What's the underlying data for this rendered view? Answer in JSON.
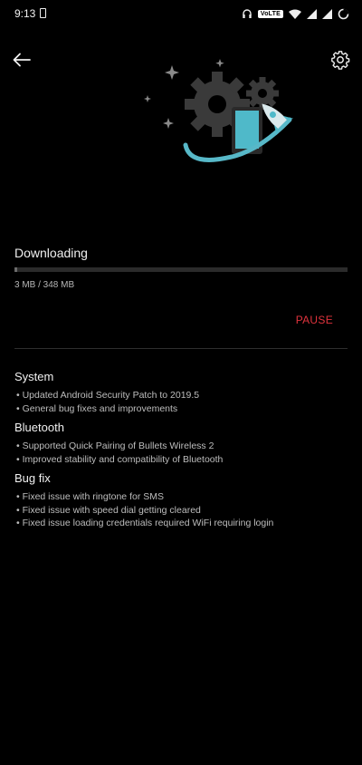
{
  "status_bar": {
    "time": "9:13",
    "network_badge": "VoLTE"
  },
  "header": {
    "back_icon": "arrow-left-icon",
    "settings_icon": "gear-icon"
  },
  "download": {
    "title": "Downloading",
    "progress_fraction": 0.009,
    "size_text": "3 MB / 348 MB",
    "pause_label": "PAUSE",
    "pause_color": "#e0333d"
  },
  "changelog": {
    "sections": [
      {
        "title": "System",
        "items": [
          "Updated Android Security Patch to 2019.5",
          "General bug fixes and improvements"
        ]
      },
      {
        "title": "Bluetooth",
        "items": [
          "Supported Quick Pairing of Bullets Wireless 2",
          "Improved stability and compatibility of Bluetooth"
        ]
      },
      {
        "title": "Bug fix",
        "items": [
          "Fixed issue with ringtone for SMS",
          "Fixed issue with speed dial getting cleared",
          "Fixed issue loading credentials required WiFi requiring login"
        ]
      }
    ]
  }
}
